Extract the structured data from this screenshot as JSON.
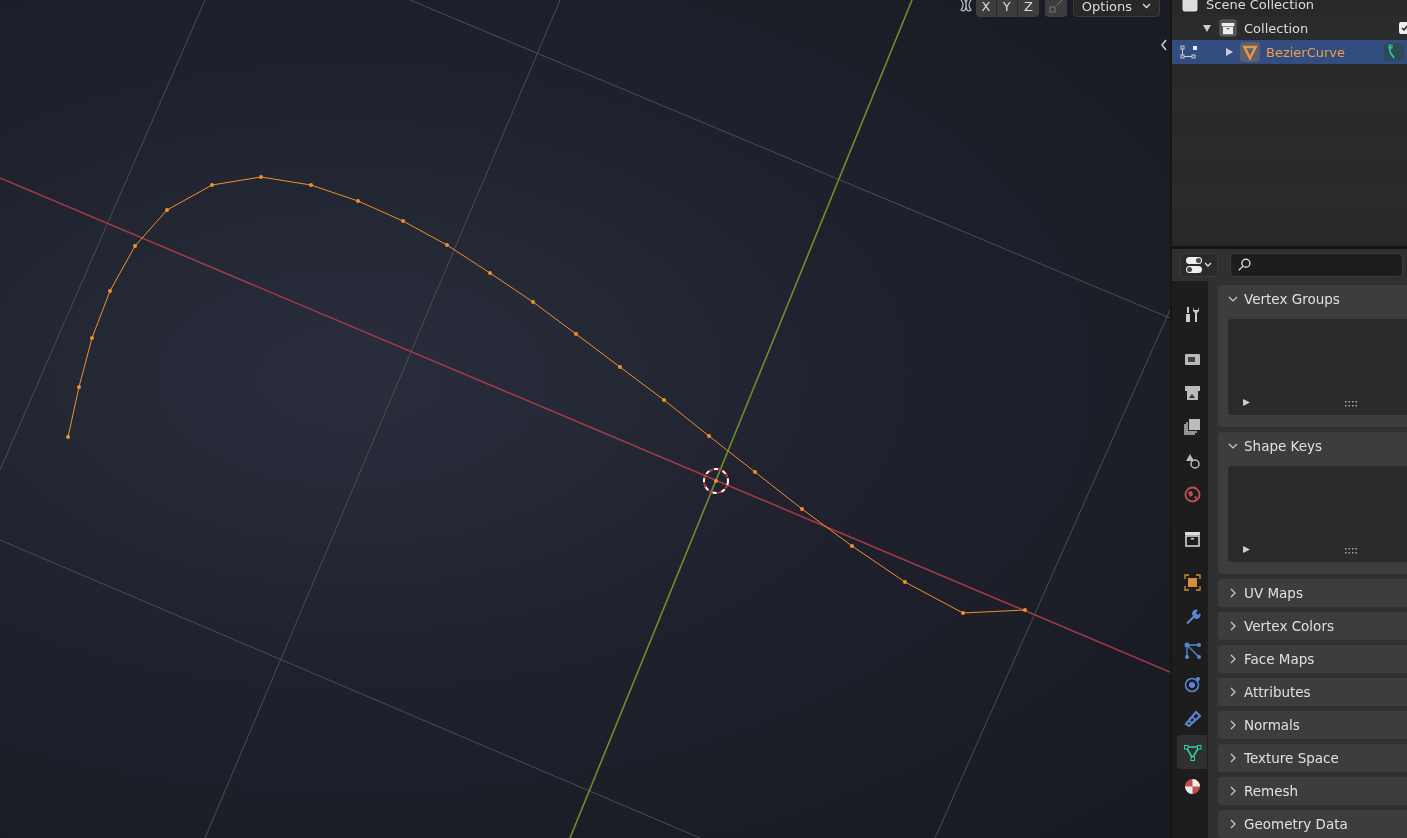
{
  "viewport": {
    "axis_buttons": [
      {
        "label": "X"
      },
      {
        "label": "Y"
      },
      {
        "label": "Z"
      }
    ],
    "options": "Options"
  },
  "outliner": {
    "items": [
      {
        "label": "Scene Collection",
        "kind": "scene",
        "children": [
          {
            "label": "Collection",
            "kind": "collection",
            "expanded": true,
            "selected": false,
            "children": [
              {
                "label": "BezierCurve",
                "kind": "curve",
                "expanded": false,
                "selected": true
              }
            ]
          }
        ]
      }
    ]
  },
  "properties": {
    "tabs": [
      {
        "kind": "tool",
        "selected": false
      },
      {
        "kind": "render",
        "selected": false
      },
      {
        "kind": "output",
        "selected": false
      },
      {
        "kind": "view_layer",
        "selected": false
      },
      {
        "kind": "scene",
        "selected": false
      },
      {
        "kind": "world",
        "selected": false
      },
      {
        "kind": "collection",
        "selected": false
      },
      {
        "kind": "object",
        "selected": false
      },
      {
        "kind": "modifiers",
        "selected": false
      },
      {
        "kind": "particles",
        "selected": false
      },
      {
        "kind": "physics",
        "selected": false
      },
      {
        "kind": "constraints",
        "selected": false
      },
      {
        "kind": "data",
        "selected": true
      },
      {
        "kind": "material",
        "selected": false
      }
    ],
    "panels": [
      {
        "title": "Vertex Groups",
        "expanded": true
      },
      {
        "title": "Shape Keys",
        "expanded": true
      },
      {
        "title": "UV Maps",
        "expanded": false
      },
      {
        "title": "Vertex Colors",
        "expanded": false
      },
      {
        "title": "Face Maps",
        "expanded": false
      },
      {
        "title": "Attributes",
        "expanded": false
      },
      {
        "title": "Normals",
        "expanded": false
      },
      {
        "title": "Texture Space",
        "expanded": false
      },
      {
        "title": "Remesh",
        "expanded": false
      },
      {
        "title": "Geometry Data",
        "expanded": false
      }
    ]
  }
}
